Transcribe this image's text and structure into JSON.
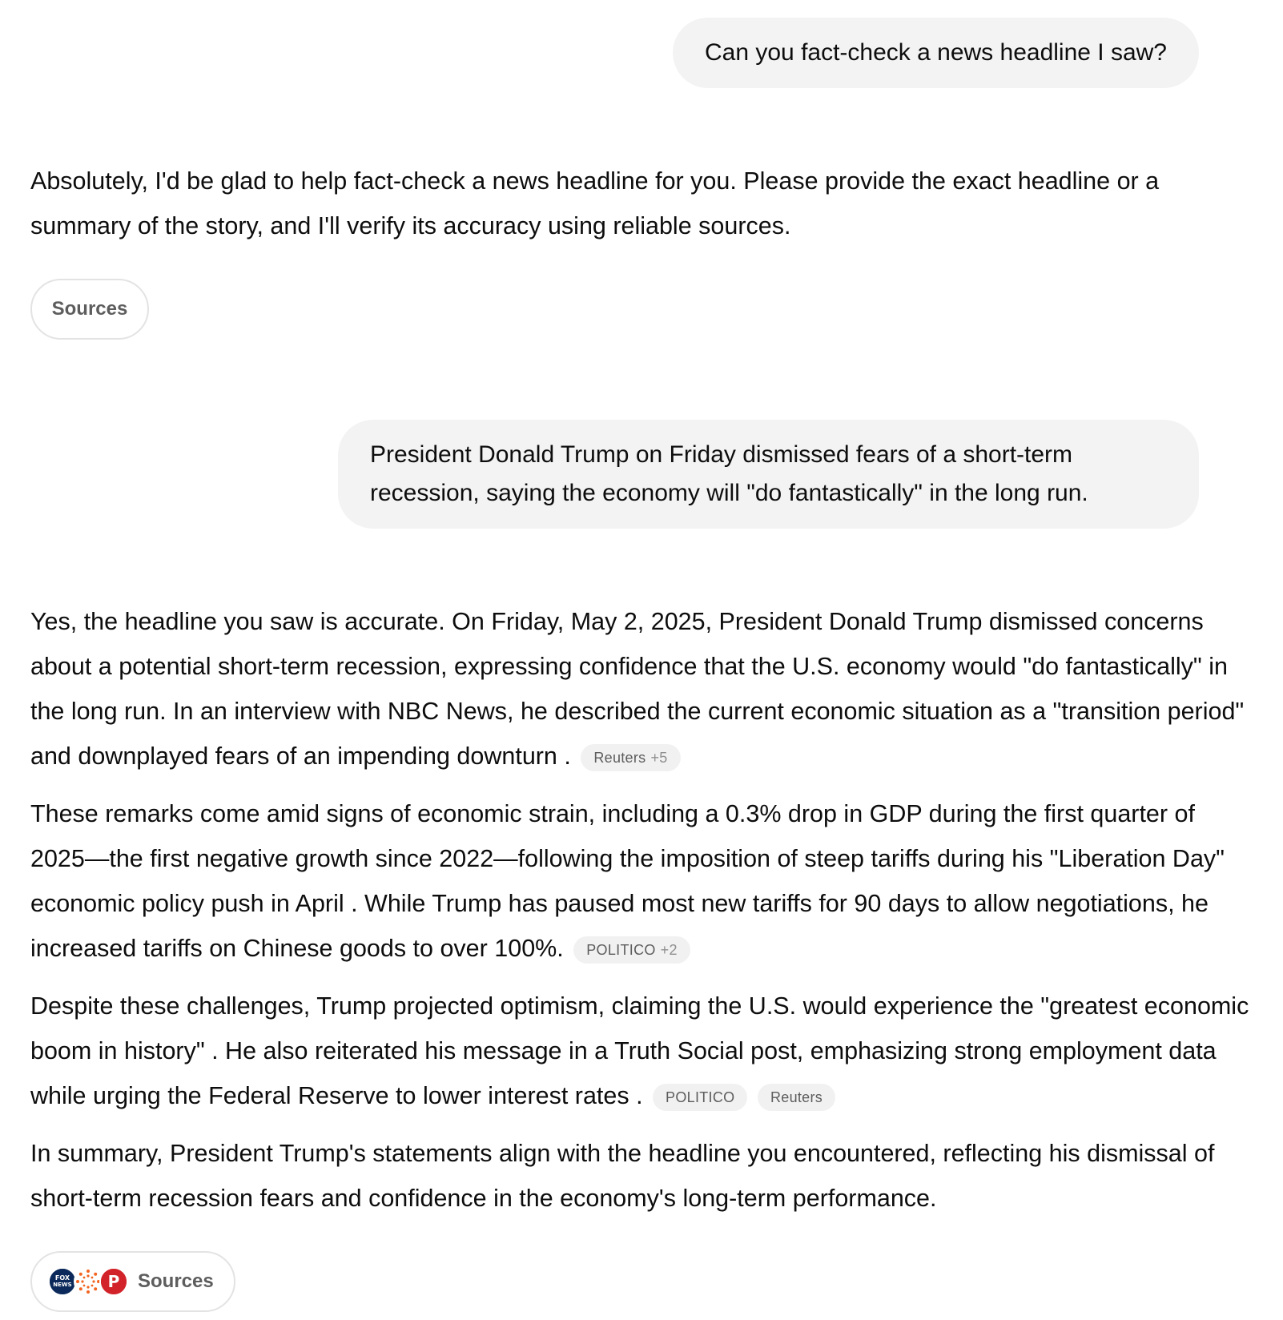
{
  "conversation": {
    "user_message_1": "Can you fact-check a news headline I saw?",
    "assistant_message_1": "Absolutely, I'd be glad to help fact-check a news headline for you. Please provide the exact headline or a summary of the story, and I'll verify its accuracy using reliable sources.",
    "sources_label_1": "Sources",
    "user_message_2": "President Donald Trump on Friday dismissed fears of a short-term recession, saying the economy will \"do fantastically\" in the long run.",
    "assistant_message_2": {
      "paragraph_1": "Yes, the headline you saw is accurate. On Friday, May 2, 2025, President Donald Trump dismissed concerns about a potential short-term recession, expressing confidence that the U.S. economy would \"do fantastically\" in the long run. In an interview with NBC News, he described the current economic situation as a \"transition period\" and downplayed fears of an impending downturn .",
      "paragraph_1_citation": {
        "source": "Reuters",
        "more": "+5"
      },
      "paragraph_2": "These remarks come amid signs of economic strain, including a 0.3% drop in GDP during the first quarter of 2025—the first negative growth since 2022—following the imposition of steep tariffs during his \"Liberation Day\" economic policy push in April . While Trump has paused most new tariffs for 90 days to allow negotiations, he increased tariffs on Chinese goods to over 100%.",
      "paragraph_2_citation": {
        "source": "POLITICO",
        "more": "+2"
      },
      "paragraph_3": "Despite these challenges, Trump projected optimism, claiming the U.S. would experience the \"greatest economic boom in history\" . He also reiterated his message in a Truth Social post, emphasizing strong employment data while urging the Federal Reserve to lower interest rates .",
      "paragraph_3_citations": [
        "POLITICO",
        "Reuters"
      ],
      "paragraph_4": "In summary, President Trump's statements align with the headline you encountered, reflecting his dismissal of short-term recession fears and confidence in the economy's long-term performance."
    },
    "sources_label_2": "Sources",
    "source_favicons": [
      {
        "name": "fox-news-icon",
        "text": "FOX NEWS",
        "color": "#0b2a5b"
      },
      {
        "name": "reuters-icon",
        "color": "#f26522"
      },
      {
        "name": "politico-icon",
        "text": "P",
        "color": "#d2232a"
      }
    ]
  }
}
